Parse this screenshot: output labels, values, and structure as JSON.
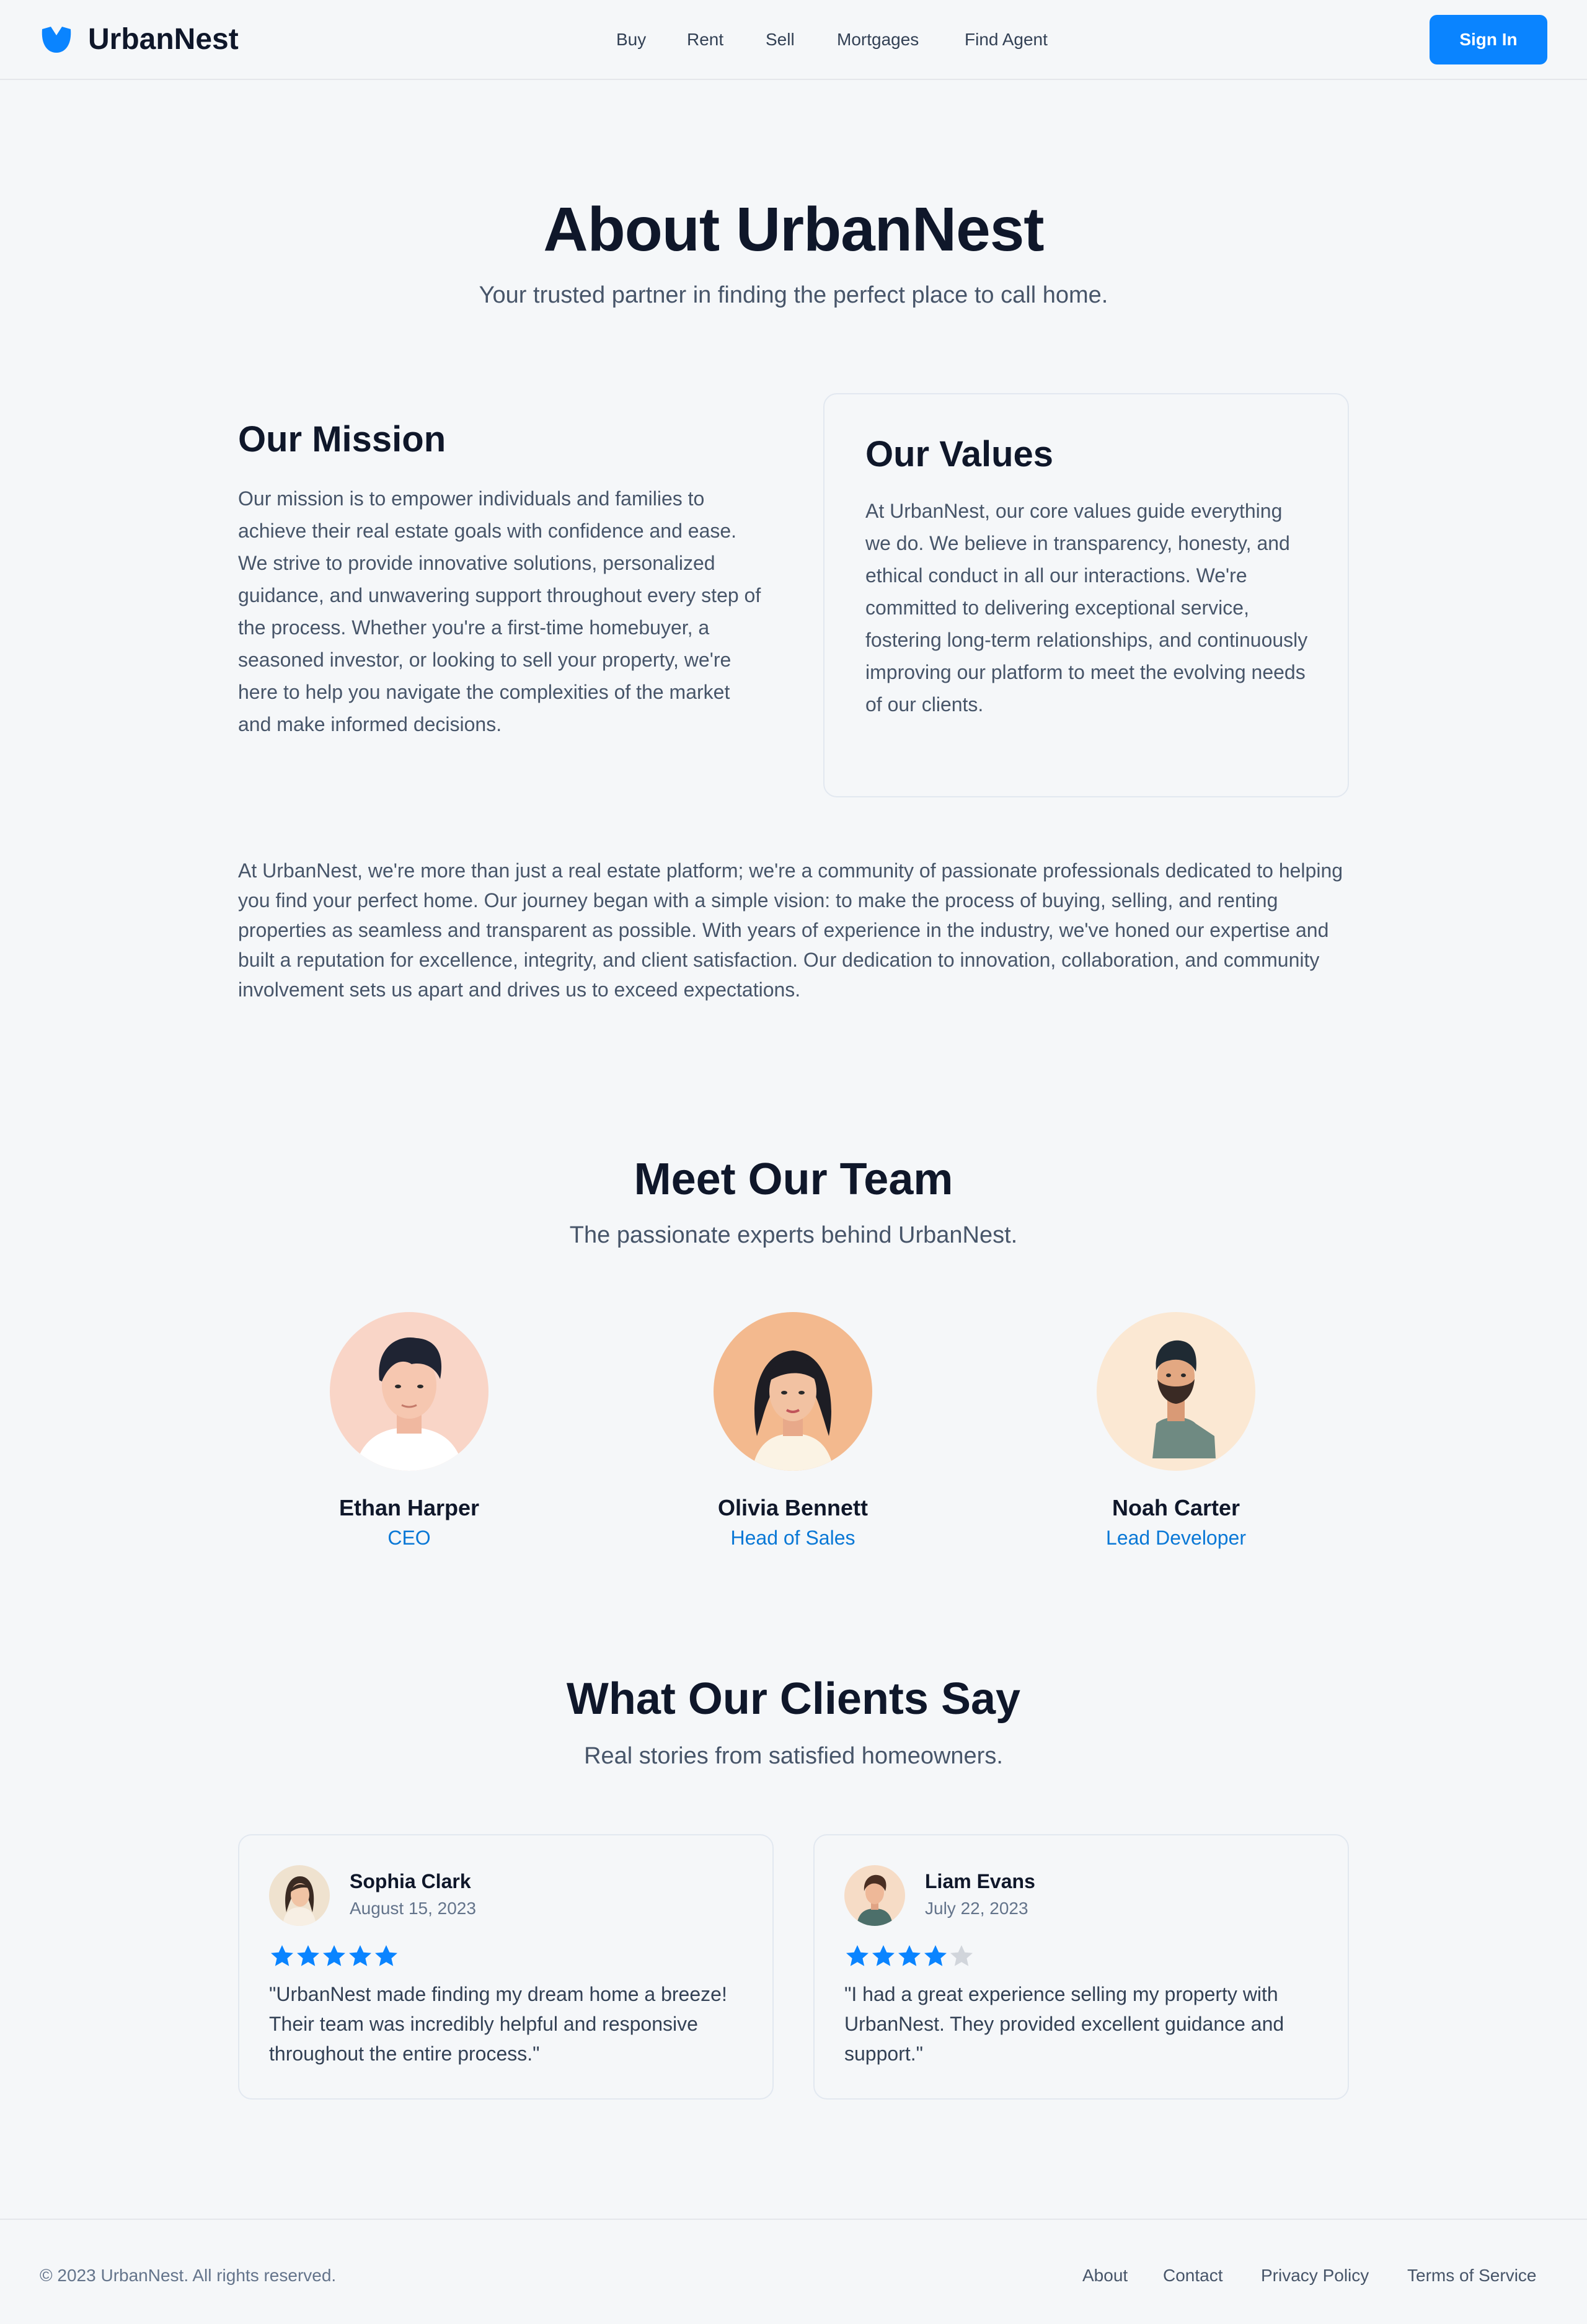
{
  "brand": {
    "name": "UrbanNest",
    "accent": "#0a84ff"
  },
  "nav": {
    "items": [
      "Buy",
      "Rent",
      "Sell",
      "Mortgages",
      "Find Agent"
    ],
    "signin_label": "Sign In"
  },
  "hero": {
    "title": "About UrbanNest",
    "subtitle": "Your trusted partner in finding the perfect place to call home."
  },
  "mission": {
    "title": "Our Mission",
    "text": "Our mission is to empower individuals and families to achieve their real estate goals with confidence and ease. We strive to provide innovative solutions, personalized guidance, and unwavering support throughout every step of the process. Whether you're a first-time homebuyer, a seasoned investor, or looking to sell your property, we're here to help you navigate the complexities of the market and make informed decisions."
  },
  "values": {
    "title": "Our Values",
    "text": "At UrbanNest, our core values guide everything we do. We believe in transparency, honesty, and ethical conduct in all our interactions. We're committed to delivering exceptional service, fostering long-term relationships, and continuously improving our platform to meet the evolving needs of our clients."
  },
  "about_paragraph": "At UrbanNest, we're more than just a real estate platform; we're a community of passionate professionals dedicated to helping you find your perfect home. Our journey began with a simple vision: to make the process of buying, selling, and renting properties as seamless and transparent as possible. With years of experience in the industry, we've honed our expertise and built a reputation for excellence, integrity, and client satisfaction. Our dedication to innovation, collaboration, and community involvement sets us apart and drives us to exceed expectations.",
  "team": {
    "title": "Meet Our Team",
    "subtitle": "The passionate experts behind UrbanNest.",
    "members": [
      {
        "name": "Ethan Harper",
        "role": "CEO",
        "avatar": "man-avatar"
      },
      {
        "name": "Olivia Bennett",
        "role": "Head of Sales",
        "avatar": "woman-avatar"
      },
      {
        "name": "Noah Carter",
        "role": "Lead Developer",
        "avatar": "bearded-man-avatar"
      }
    ]
  },
  "testimonials": {
    "title": "What Our Clients Say",
    "subtitle": "Real stories from satisfied homeowners.",
    "items": [
      {
        "name": "Sophia Clark",
        "date": "August 15, 2023",
        "rating": 5,
        "quote": "\"UrbanNest made finding my dream home a breeze! Their team was incredibly helpful and responsive throughout the entire process.\""
      },
      {
        "name": "Liam Evans",
        "date": "July 22, 2023",
        "rating": 4,
        "quote": "\"I had a great experience selling my property with UrbanNest. They provided excellent guidance and support.\""
      }
    ]
  },
  "footer": {
    "copyright": "© 2023 UrbanNest. All rights reserved.",
    "links": [
      "About",
      "Contact",
      "Privacy Policy",
      "Terms of Service"
    ]
  }
}
